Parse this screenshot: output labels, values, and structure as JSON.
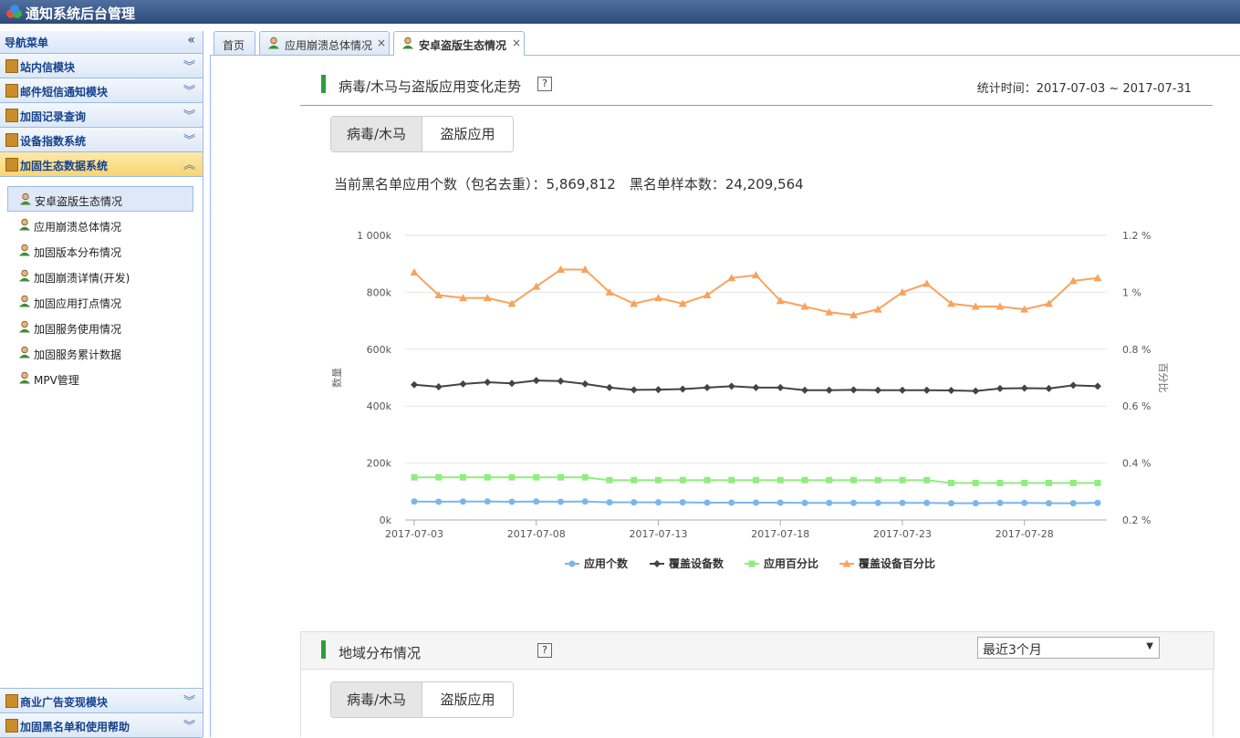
{
  "app": {
    "title": "通知系统后台管理"
  },
  "sidebar": {
    "header": "导航菜单",
    "collapse_icon": "double-chevron-left-icon",
    "modules": [
      {
        "label": "站内信模块"
      },
      {
        "label": "邮件短信通知模块"
      },
      {
        "label": "加固记录查询"
      },
      {
        "label": "设备指数系统"
      },
      {
        "label": "加固生态数据系统"
      }
    ],
    "submenu": [
      {
        "label": "安卓盗版生态情况"
      },
      {
        "label": "应用崩溃总体情况"
      },
      {
        "label": "加固版本分布情况"
      },
      {
        "label": "加固崩溃详情(开发)"
      },
      {
        "label": "加固应用打点情况"
      },
      {
        "label": "加固服务使用情况"
      },
      {
        "label": "加固服务累计数据"
      },
      {
        "label": "MPV管理"
      }
    ],
    "bottom_modules": [
      {
        "label": "商业广告变现模块"
      },
      {
        "label": "加固黑名单和使用帮助"
      }
    ]
  },
  "tabs": [
    {
      "label": "首页"
    },
    {
      "label": "应用崩溃总体情况",
      "close": "×"
    },
    {
      "label": "安卓盗版生态情况",
      "close": "×"
    }
  ],
  "section1": {
    "title": "病毒/木马与盗版应用变化走势",
    "help": "?",
    "stat_time": "统计时间：2017-07-03 ~ 2017-07-31",
    "toggle": [
      "病毒/木马",
      "盗版应用"
    ],
    "summary": "当前黑名单应用个数（包名去重）：5,869,812　黑名单样本数：24,209,564"
  },
  "section2": {
    "title": "地域分布情况",
    "help": "?",
    "select_value": "最近3个月",
    "toggle": [
      "病毒/木马",
      "盗版应用"
    ]
  },
  "chart_data": {
    "type": "line",
    "ylabel": "数量",
    "y2label": "百分比",
    "ylim": [
      0,
      1000000
    ],
    "y2lim": [
      0.2,
      1.2
    ],
    "y_ticks": [
      "0k",
      "200k",
      "400k",
      "600k",
      "800k",
      "1 000k"
    ],
    "y2_ticks": [
      "0.2 %",
      "0.4 %",
      "0.6 %",
      "0.8 %",
      "1 %",
      "1.2 %"
    ],
    "x_ticks": [
      "2017-07-03",
      "2017-07-08",
      "2017-07-13",
      "2017-07-18",
      "2017-07-23",
      "2017-07-28"
    ],
    "x": [
      "2017-07-03",
      "2017-07-04",
      "2017-07-05",
      "2017-07-06",
      "2017-07-07",
      "2017-07-08",
      "2017-07-09",
      "2017-07-10",
      "2017-07-11",
      "2017-07-12",
      "2017-07-13",
      "2017-07-14",
      "2017-07-15",
      "2017-07-16",
      "2017-07-17",
      "2017-07-18",
      "2017-07-19",
      "2017-07-20",
      "2017-07-21",
      "2017-07-22",
      "2017-07-23",
      "2017-07-24",
      "2017-07-25",
      "2017-07-26",
      "2017-07-27",
      "2017-07-28",
      "2017-07-29",
      "2017-07-30",
      "2017-07-31"
    ],
    "series": [
      {
        "name": "应用个数",
        "axis": "left",
        "color": "#7cb5ec",
        "marker": "circle",
        "values": [
          65000,
          64000,
          65000,
          65000,
          64000,
          65000,
          64000,
          65000,
          62000,
          62000,
          62000,
          62000,
          61000,
          61000,
          61000,
          61000,
          60000,
          60000,
          60000,
          60000,
          60000,
          60000,
          59000,
          59000,
          60000,
          60000,
          59000,
          59000,
          60000
        ]
      },
      {
        "name": "覆盖设备数",
        "axis": "left",
        "color": "#434348",
        "marker": "diamond",
        "values": [
          475000,
          468000,
          478000,
          484000,
          480000,
          490000,
          488000,
          478000,
          465000,
          457000,
          458000,
          460000,
          465000,
          470000,
          465000,
          465000,
          456000,
          456000,
          457000,
          456000,
          456000,
          456000,
          455000,
          453000,
          462000,
          463000,
          462000,
          473000,
          470000
        ]
      },
      {
        "name": "应用百分比",
        "axis": "right",
        "color": "#90ed7d",
        "marker": "square",
        "values": [
          0.35,
          0.35,
          0.35,
          0.35,
          0.35,
          0.35,
          0.35,
          0.35,
          0.34,
          0.34,
          0.34,
          0.34,
          0.34,
          0.34,
          0.34,
          0.34,
          0.34,
          0.34,
          0.34,
          0.34,
          0.34,
          0.34,
          0.33,
          0.33,
          0.33,
          0.33,
          0.33,
          0.33,
          0.33
        ]
      },
      {
        "name": "覆盖设备百分比",
        "axis": "right",
        "color": "#f7a35c",
        "marker": "triangle",
        "values": [
          1.07,
          0.99,
          0.98,
          0.98,
          0.96,
          1.02,
          1.08,
          1.08,
          1.0,
          0.96,
          0.98,
          0.96,
          0.99,
          1.05,
          1.06,
          0.97,
          0.95,
          0.93,
          0.92,
          0.94,
          1.0,
          1.03,
          0.96,
          0.95,
          0.95,
          0.94,
          0.96,
          1.04,
          1.05
        ]
      }
    ]
  }
}
